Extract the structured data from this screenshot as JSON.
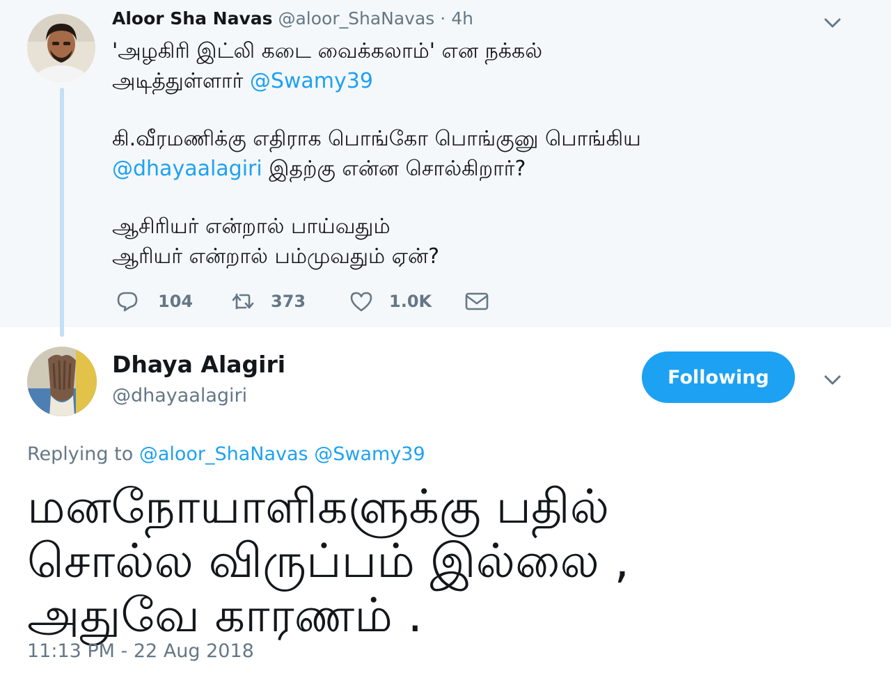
{
  "parent_tweet": {
    "author_name": "Aloor Sha Navas",
    "author_handle": "@aloor_ShaNavas",
    "separator": "·",
    "time": "4h",
    "lines": [
      {
        "pre": "'அழகிரி இட்லி கடை வைக்கலாம்' என நக்கல்",
        "mention": "",
        "post": ""
      },
      {
        "pre": "அடித்துள்ளார் ",
        "mention": "@Swamy39",
        "post": ""
      },
      {
        "pre": "",
        "mention": "",
        "post": ""
      },
      {
        "pre": "கி.வீரமணிக்கு எதிராக பொங்கோ பொங்குனு பொங்கிய",
        "mention": "",
        "post": ""
      },
      {
        "pre": "",
        "mention": "@dhayaalagiri",
        "post": " இதற்கு என்ன சொல்கிறார்?"
      },
      {
        "pre": "",
        "mention": "",
        "post": ""
      },
      {
        "pre": "ஆசிரியர் என்றால் பாய்வதும்",
        "mention": "",
        "post": ""
      },
      {
        "pre": "ஆரியர் என்றால் பம்முவதும் ஏன்?",
        "mention": "",
        "post": ""
      }
    ],
    "actions": {
      "reply_count": "104",
      "retweet_count": "373",
      "like_count": "1.0K"
    }
  },
  "reply_tweet": {
    "author_name": "Dhaya Alagiri",
    "author_handle": "@dhayaalagiri",
    "follow_label": "Following",
    "replying_prefix": "Replying to ",
    "replying_mention_1": "@aloor_ShaNavas",
    "replying_mention_2": "@Swamy39",
    "text_lines": [
      "மனநோயாளிகளுக்கு பதில்",
      "சொல்ல விருப்பம் இல்லை ,",
      "அதுவே காரணம் ."
    ],
    "timestamp": "11:13 PM - 22 Aug 2018"
  },
  "colors": {
    "accent": "#1da1f2",
    "muted": "#657786",
    "text": "#14171a",
    "parent_bg": "#f5f8fa",
    "thread_line": "#c3e0f5"
  },
  "icons": {
    "reply": "reply-icon",
    "retweet": "retweet-icon",
    "like": "heart-icon",
    "dm": "envelope-icon",
    "menu": "chevron-down-icon"
  }
}
